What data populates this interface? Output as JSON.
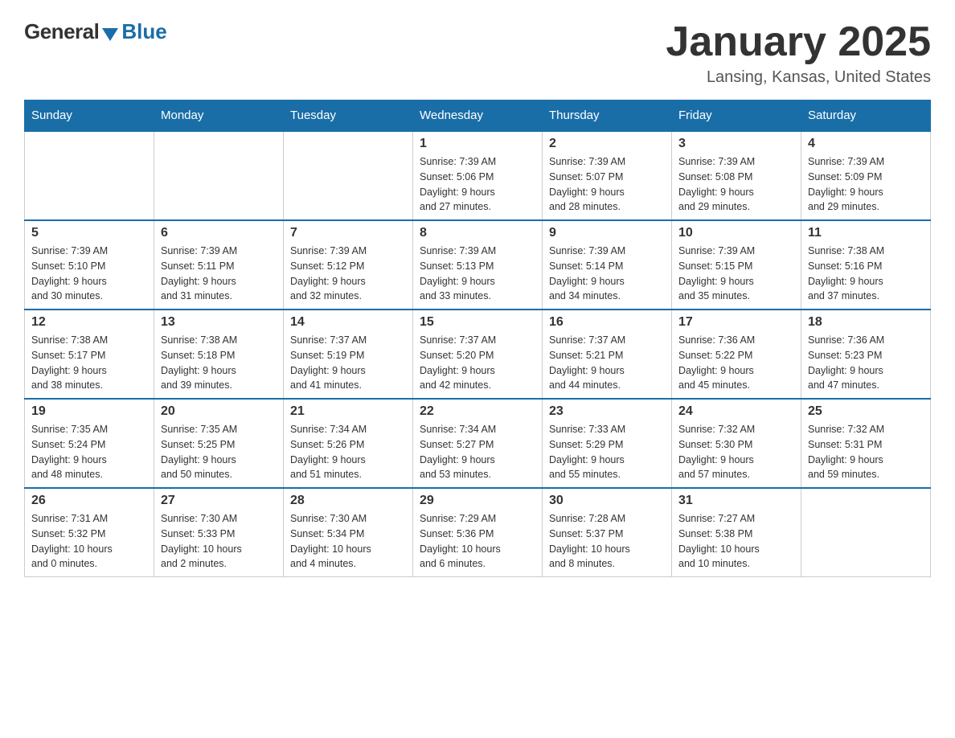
{
  "logo": {
    "general": "General",
    "blue": "Blue"
  },
  "title": "January 2025",
  "location": "Lansing, Kansas, United States",
  "days_of_week": [
    "Sunday",
    "Monday",
    "Tuesday",
    "Wednesday",
    "Thursday",
    "Friday",
    "Saturday"
  ],
  "weeks": [
    [
      {
        "day": "",
        "info": ""
      },
      {
        "day": "",
        "info": ""
      },
      {
        "day": "",
        "info": ""
      },
      {
        "day": "1",
        "info": "Sunrise: 7:39 AM\nSunset: 5:06 PM\nDaylight: 9 hours\nand 27 minutes."
      },
      {
        "day": "2",
        "info": "Sunrise: 7:39 AM\nSunset: 5:07 PM\nDaylight: 9 hours\nand 28 minutes."
      },
      {
        "day": "3",
        "info": "Sunrise: 7:39 AM\nSunset: 5:08 PM\nDaylight: 9 hours\nand 29 minutes."
      },
      {
        "day": "4",
        "info": "Sunrise: 7:39 AM\nSunset: 5:09 PM\nDaylight: 9 hours\nand 29 minutes."
      }
    ],
    [
      {
        "day": "5",
        "info": "Sunrise: 7:39 AM\nSunset: 5:10 PM\nDaylight: 9 hours\nand 30 minutes."
      },
      {
        "day": "6",
        "info": "Sunrise: 7:39 AM\nSunset: 5:11 PM\nDaylight: 9 hours\nand 31 minutes."
      },
      {
        "day": "7",
        "info": "Sunrise: 7:39 AM\nSunset: 5:12 PM\nDaylight: 9 hours\nand 32 minutes."
      },
      {
        "day": "8",
        "info": "Sunrise: 7:39 AM\nSunset: 5:13 PM\nDaylight: 9 hours\nand 33 minutes."
      },
      {
        "day": "9",
        "info": "Sunrise: 7:39 AM\nSunset: 5:14 PM\nDaylight: 9 hours\nand 34 minutes."
      },
      {
        "day": "10",
        "info": "Sunrise: 7:39 AM\nSunset: 5:15 PM\nDaylight: 9 hours\nand 35 minutes."
      },
      {
        "day": "11",
        "info": "Sunrise: 7:38 AM\nSunset: 5:16 PM\nDaylight: 9 hours\nand 37 minutes."
      }
    ],
    [
      {
        "day": "12",
        "info": "Sunrise: 7:38 AM\nSunset: 5:17 PM\nDaylight: 9 hours\nand 38 minutes."
      },
      {
        "day": "13",
        "info": "Sunrise: 7:38 AM\nSunset: 5:18 PM\nDaylight: 9 hours\nand 39 minutes."
      },
      {
        "day": "14",
        "info": "Sunrise: 7:37 AM\nSunset: 5:19 PM\nDaylight: 9 hours\nand 41 minutes."
      },
      {
        "day": "15",
        "info": "Sunrise: 7:37 AM\nSunset: 5:20 PM\nDaylight: 9 hours\nand 42 minutes."
      },
      {
        "day": "16",
        "info": "Sunrise: 7:37 AM\nSunset: 5:21 PM\nDaylight: 9 hours\nand 44 minutes."
      },
      {
        "day": "17",
        "info": "Sunrise: 7:36 AM\nSunset: 5:22 PM\nDaylight: 9 hours\nand 45 minutes."
      },
      {
        "day": "18",
        "info": "Sunrise: 7:36 AM\nSunset: 5:23 PM\nDaylight: 9 hours\nand 47 minutes."
      }
    ],
    [
      {
        "day": "19",
        "info": "Sunrise: 7:35 AM\nSunset: 5:24 PM\nDaylight: 9 hours\nand 48 minutes."
      },
      {
        "day": "20",
        "info": "Sunrise: 7:35 AM\nSunset: 5:25 PM\nDaylight: 9 hours\nand 50 minutes."
      },
      {
        "day": "21",
        "info": "Sunrise: 7:34 AM\nSunset: 5:26 PM\nDaylight: 9 hours\nand 51 minutes."
      },
      {
        "day": "22",
        "info": "Sunrise: 7:34 AM\nSunset: 5:27 PM\nDaylight: 9 hours\nand 53 minutes."
      },
      {
        "day": "23",
        "info": "Sunrise: 7:33 AM\nSunset: 5:29 PM\nDaylight: 9 hours\nand 55 minutes."
      },
      {
        "day": "24",
        "info": "Sunrise: 7:32 AM\nSunset: 5:30 PM\nDaylight: 9 hours\nand 57 minutes."
      },
      {
        "day": "25",
        "info": "Sunrise: 7:32 AM\nSunset: 5:31 PM\nDaylight: 9 hours\nand 59 minutes."
      }
    ],
    [
      {
        "day": "26",
        "info": "Sunrise: 7:31 AM\nSunset: 5:32 PM\nDaylight: 10 hours\nand 0 minutes."
      },
      {
        "day": "27",
        "info": "Sunrise: 7:30 AM\nSunset: 5:33 PM\nDaylight: 10 hours\nand 2 minutes."
      },
      {
        "day": "28",
        "info": "Sunrise: 7:30 AM\nSunset: 5:34 PM\nDaylight: 10 hours\nand 4 minutes."
      },
      {
        "day": "29",
        "info": "Sunrise: 7:29 AM\nSunset: 5:36 PM\nDaylight: 10 hours\nand 6 minutes."
      },
      {
        "day": "30",
        "info": "Sunrise: 7:28 AM\nSunset: 5:37 PM\nDaylight: 10 hours\nand 8 minutes."
      },
      {
        "day": "31",
        "info": "Sunrise: 7:27 AM\nSunset: 5:38 PM\nDaylight: 10 hours\nand 10 minutes."
      },
      {
        "day": "",
        "info": ""
      }
    ]
  ]
}
